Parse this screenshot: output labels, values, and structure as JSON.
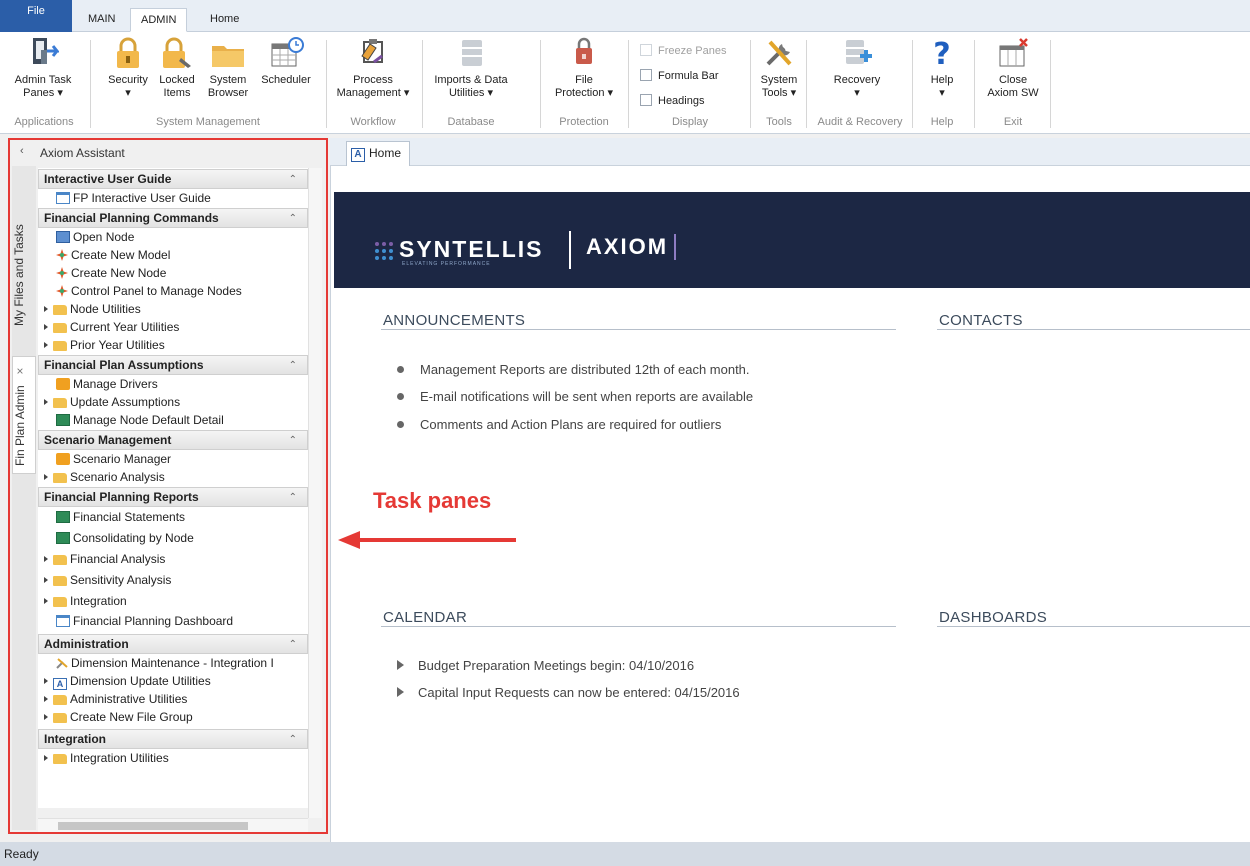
{
  "ribbon_tabs": [
    "File",
    "MAIN",
    "ADMIN",
    "Home"
  ],
  "ribbon": {
    "buttons": {
      "admin_task_panes": [
        "Admin Task",
        "Panes ▾"
      ],
      "security": [
        "Security",
        "▾"
      ],
      "locked_items": [
        "Locked",
        "Items"
      ],
      "system_browser": [
        "System",
        "Browser"
      ],
      "scheduler": [
        "Scheduler"
      ],
      "process_management": [
        "Process",
        "Management ▾"
      ],
      "imports_data_utilities": [
        "Imports & Data",
        "Utilities ▾"
      ],
      "file_protection": [
        "File",
        "Protection ▾"
      ],
      "system_tools": [
        "System",
        "Tools ▾"
      ],
      "recovery": [
        "Recovery",
        "▾"
      ],
      "help": [
        "Help",
        "▾"
      ],
      "close_axiom": [
        "Close",
        "Axiom SW"
      ]
    },
    "checkboxes": {
      "freeze_panes": "Freeze Panes",
      "formula_bar": "Formula Bar",
      "headings": "Headings"
    },
    "groups": {
      "applications": "Applications",
      "system_management": "System Management",
      "workflow": "Workflow",
      "database": "Database",
      "protection": "Protection",
      "display": "Display",
      "tools": "Tools",
      "audit_recovery": "Audit & Recovery",
      "help": "Help",
      "exit": "Exit"
    }
  },
  "assistant": {
    "title": "Axiom Assistant",
    "vertical_tabs": [
      "My Files and Tasks",
      "Fin Plan Admin"
    ],
    "sections": [
      {
        "title": "Interactive User Guide",
        "items": [
          {
            "label": "FP Interactive User Guide",
            "icon": "doc"
          }
        ]
      },
      {
        "title": "Financial Planning Commands",
        "items": [
          {
            "label": "Open Node",
            "icon": "node"
          },
          {
            "label": "Create New Model",
            "icon": "star"
          },
          {
            "label": "Create New Node",
            "icon": "star"
          },
          {
            "label": "Control Panel to Manage Nodes",
            "icon": "star"
          },
          {
            "label": "Node Utilities",
            "icon": "folder",
            "expandable": true
          },
          {
            "label": "Current Year Utilities",
            "icon": "folder",
            "expandable": true
          },
          {
            "label": "Prior Year Utilities",
            "icon": "folder",
            "expandable": true
          }
        ]
      },
      {
        "title": "Financial Plan Assumptions",
        "items": [
          {
            "label": "Manage Drivers",
            "icon": "gear"
          },
          {
            "label": "Update Assumptions",
            "icon": "folder",
            "expandable": true
          },
          {
            "label": "Manage Node Default Detail",
            "icon": "xl"
          }
        ]
      },
      {
        "title": "Scenario Management",
        "items": [
          {
            "label": "Scenario Manager",
            "icon": "gear"
          },
          {
            "label": "Scenario Analysis",
            "icon": "folder",
            "expandable": true
          }
        ]
      },
      {
        "title": "Financial Planning Reports",
        "items": [
          {
            "label": "Financial Statements",
            "icon": "xl"
          },
          {
            "label": "Consolidating by Node",
            "icon": "xl"
          },
          {
            "label": "Financial Analysis",
            "icon": "folder",
            "expandable": true
          },
          {
            "label": "Sensitivity Analysis",
            "icon": "folder",
            "expandable": true
          },
          {
            "label": "Integration",
            "icon": "folder",
            "expandable": true
          },
          {
            "label": "Financial Planning Dashboard",
            "icon": "doc"
          }
        ]
      },
      {
        "title": "Administration",
        "items": [
          {
            "label": "Dimension Maintenance - Integration I",
            "icon": "tool"
          },
          {
            "label": "Dimension Update Utilities",
            "icon": "afile",
            "expandable": true
          },
          {
            "label": "Administrative Utilities",
            "icon": "folder",
            "expandable": true
          },
          {
            "label": "Create New File Group",
            "icon": "folder",
            "expandable": true
          }
        ]
      },
      {
        "title": "Integration",
        "items": [
          {
            "label": "Integration Utilities",
            "icon": "folder",
            "expandable": true
          }
        ]
      }
    ]
  },
  "doc_tab": "Home",
  "banner": {
    "brand": "SYNTELLIS",
    "tagline": "ELEVATING PERFORMANCE",
    "product": "AXIOM"
  },
  "announcements": {
    "title": "ANNOUNCEMENTS",
    "items": [
      "Management Reports are distributed 12th of each month.",
      "E-mail notifications will be sent when reports are available",
      "Comments and Action Plans are required for outliers"
    ]
  },
  "contacts": {
    "title": "CONTACTS"
  },
  "calendar": {
    "title": "CALENDAR",
    "items": [
      "Budget Preparation Meetings begin: 04/10/2016",
      "Capital Input Requests can now be entered: 04/15/2016"
    ]
  },
  "dashboards": {
    "title": "DASHBOARDS"
  },
  "annotation": "Task panes",
  "status": "Ready",
  "colors": {
    "ribbon_file_tab": "#2b5ea8",
    "banner": "#1c2744",
    "annotation": "#e53935"
  }
}
